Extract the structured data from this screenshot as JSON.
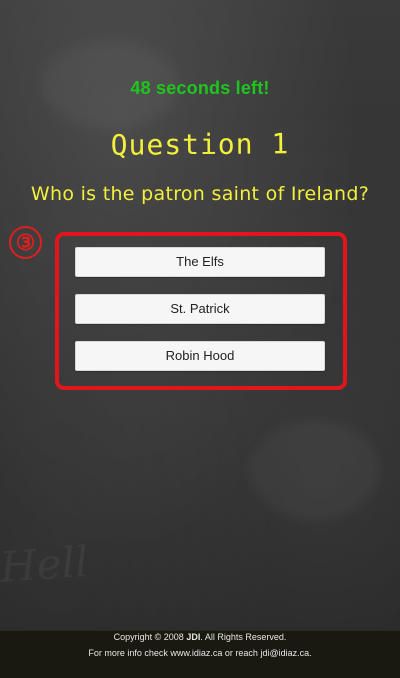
{
  "timer": {
    "text": "48 seconds left!"
  },
  "question": {
    "title": "Question 1",
    "text": "Who is the patron saint of Ireland?"
  },
  "annotation": {
    "marker": "③"
  },
  "answers": [
    {
      "label": "The Elfs"
    },
    {
      "label": "St. Patrick"
    },
    {
      "label": "Robin Hood"
    }
  ],
  "footer": {
    "copyright_prefix": "Copyright © 2008",
    "company": "JDI",
    "copyright_suffix": ". All Rights Reserved.",
    "info": "For more info check www.idiaz.ca or reach jdi@idiaz.ca."
  },
  "colors": {
    "timer": "#1ec51e",
    "chalk_yellow": "#f3ef3c",
    "annotation_red": "#e0161c"
  }
}
